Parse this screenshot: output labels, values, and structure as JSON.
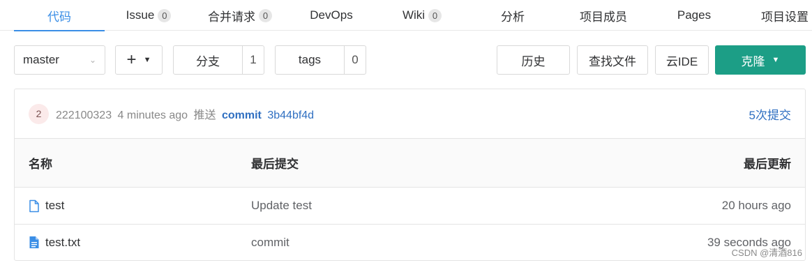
{
  "tabs": [
    {
      "label": "代码",
      "badge": null
    },
    {
      "label": "Issue",
      "badge": "0"
    },
    {
      "label": "合并请求",
      "badge": "0"
    },
    {
      "label": "DevOps",
      "badge": null
    },
    {
      "label": "Wiki",
      "badge": "0"
    },
    {
      "label": "分析",
      "badge": null
    },
    {
      "label": "项目成员",
      "badge": null
    },
    {
      "label": "Pages",
      "badge": null
    },
    {
      "label": "项目设置",
      "badge": null
    }
  ],
  "toolbar": {
    "branch_select": "master",
    "branch_label": "分支",
    "branch_count": "1",
    "tags_label": "tags",
    "tags_count": "0",
    "history_label": "历史",
    "find_file_label": "查找文件",
    "cloud_ide_label": "云IDE",
    "clone_label": "克隆"
  },
  "commit": {
    "avatar_text": "2",
    "author": "222100323",
    "time": "4 minutes ago",
    "action": "推送",
    "message": "commit",
    "hash": "3b44bf4d",
    "count_label": "5次提交"
  },
  "table": {
    "headers": [
      "名称",
      "最后提交",
      "最后更新"
    ],
    "rows": [
      {
        "name": "test",
        "last_commit": "Update test",
        "updated": "20 hours ago",
        "icon": "file-outline-icon"
      },
      {
        "name": "test.txt",
        "last_commit": "commit",
        "updated": "39 seconds ago",
        "icon": "file-text-icon"
      }
    ]
  },
  "watermark": "CSDN @清酒816",
  "colors": {
    "accent": "#3a8ee6",
    "clone": "#1c9e86",
    "link": "#2f6fc1"
  }
}
